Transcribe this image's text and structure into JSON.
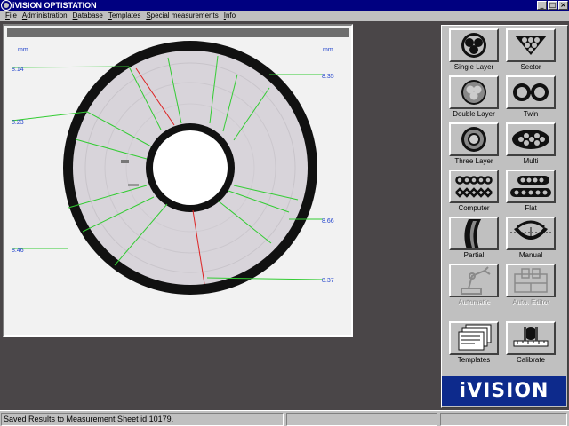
{
  "window": {
    "title": "iVISION OPTISTATION",
    "buttons": {
      "minimize": "_",
      "maximize": "□",
      "close": "×"
    }
  },
  "menu": [
    "File",
    "Administration",
    "Database",
    "Templates",
    "Special measurements",
    "Info"
  ],
  "canvas": {
    "unit_left": "mm",
    "unit_right": "mm",
    "measurements_left": [
      "8.14",
      "8.23",
      "8.46"
    ],
    "measurements_right": [
      "8.35",
      "8.66",
      "8.37"
    ]
  },
  "tools": [
    {
      "label": "Single Layer",
      "icon": "single-layer-icon",
      "enabled": true
    },
    {
      "label": "Sector",
      "icon": "sector-icon",
      "enabled": true
    },
    {
      "label": "Double Layer",
      "icon": "double-layer-icon",
      "enabled": true
    },
    {
      "label": "Twin",
      "icon": "twin-icon",
      "enabled": true
    },
    {
      "label": "Three Layer",
      "icon": "three-layer-icon",
      "enabled": true
    },
    {
      "label": "Multi",
      "icon": "multi-icon",
      "enabled": true
    },
    {
      "label": "Computer",
      "icon": "computer-cable-icon",
      "enabled": true
    },
    {
      "label": "Flat",
      "icon": "flat-cable-icon",
      "enabled": true
    },
    {
      "label": "Partial",
      "icon": "partial-icon",
      "enabled": true
    },
    {
      "label": "Manual",
      "icon": "manual-icon",
      "enabled": true
    },
    {
      "label": "Automatic",
      "icon": "robot-arm-icon",
      "enabled": false
    },
    {
      "label": "Auto. Editor",
      "icon": "auto-editor-icon",
      "enabled": false
    },
    {
      "label": "Templates",
      "icon": "templates-icon",
      "enabled": true
    },
    {
      "label": "Calibrate",
      "icon": "calibrate-icon",
      "enabled": true
    }
  ],
  "logo": "iVISION",
  "status": {
    "message": "Saved Results to Measurement Sheet id 10179.",
    "pane2": "",
    "pane3": ""
  },
  "colors": {
    "title_bar": "#000080",
    "measure_line": "#33cc33",
    "min_line": "#dd2222",
    "label_text": "#2244cc",
    "logo_bg": "#0d2a8c"
  }
}
